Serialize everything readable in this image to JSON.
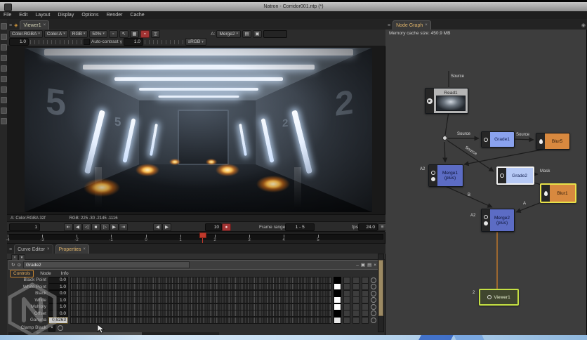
{
  "title_bar": {
    "title": "Natron - Corridor001.ntp (*)"
  },
  "menu_bar": {
    "items": [
      "File",
      "Edit",
      "Layout",
      "Display",
      "Options",
      "Render",
      "Cache"
    ]
  },
  "icons": {
    "close": "×",
    "caret": "▾",
    "menu": "≡",
    "focus": "◈",
    "prev_kf": "⇤",
    "prev_frame": "◀",
    "play_backward": "◁",
    "stop": "■",
    "play_forward": "▷",
    "next_frame": "▶",
    "next_kf": "⇥",
    "in_arrow": "◀",
    "out_arrow": "▶",
    "rec": "●",
    "snapshot": "◉",
    "gamma": "γ",
    "check": "✓",
    "refresh": "↻",
    "center": "⊙",
    "minimize": "–",
    "float": "▣",
    "grid": "▤",
    "pointer": "↖",
    "checker": "▦",
    "proxy": "▫",
    "wipe": "◫",
    "node_play": "▶",
    "pane_extra": "▪"
  },
  "viewer": {
    "tab": "Viewer1",
    "layer": "Color.RGBA",
    "alpha_channel": "Color.A",
    "display_channels": "RGB",
    "zoom": "50%",
    "gain": "1.0",
    "auto_contrast": "Auto-contrast",
    "gamma_value": "1.0",
    "colorspace": "sRGB",
    "ab_label": "A:",
    "ab_input": "Merge2",
    "info_format": "A: Color.RGBA 32f",
    "info_rgb": "RGB: 225 .30 .2145 .1116",
    "current_frame": "1",
    "playhead_frame": "10",
    "frame_range_label": "Frame range",
    "frame_range_value": "1 - 5",
    "fps_label": "fps",
    "fps_value": "24.0",
    "timeline_ticks": [
      "-4",
      "-3",
      "-2",
      "-1",
      "0",
      "1",
      "2",
      "3",
      "4",
      "5"
    ]
  },
  "image": {
    "left_wall_digit": "5",
    "right_wall_digit": "2",
    "left_wall_digit_small": "5",
    "right_wall_digit_small": "2"
  },
  "node_graph": {
    "tab": "Node Graph",
    "memory_status": "Memory cache size: 450.9 MB",
    "nodes": {
      "read1": "Read1",
      "grade1": "Grade1",
      "blur5": "Blur5",
      "merge1": "Merge1",
      "merge1_op": "(plus)",
      "grade2": "Grade2",
      "blur1": "Blur1",
      "merge2": "Merge2",
      "merge2_op": "(plus)",
      "viewer1": "Viewer1"
    },
    "edge_labels": {
      "read_source": "Source",
      "grade1_source": "Source",
      "blur5_source": "Source",
      "grade2_source": "Source",
      "merge1_a2": "A2",
      "merge2_a2": "A2",
      "merge2_b": "B",
      "merge2_a": "A",
      "grade2_mask": "Mask",
      "viewer_input": "2"
    }
  },
  "properties": {
    "tab_curve_editor": "Curve Editor",
    "tab_properties": "Properties",
    "node_name": "Grade2",
    "subtabs": [
      "Controls",
      "Node",
      "Info"
    ],
    "params": [
      {
        "label": "Black Point",
        "value": "0.0",
        "swatch": "#000000"
      },
      {
        "label": "White Point",
        "value": "1.0",
        "swatch": "#ffffff"
      },
      {
        "label": "Black",
        "value": "0.0",
        "swatch": "#000000"
      },
      {
        "label": "White",
        "value": "1.0",
        "swatch": "#ffffff"
      },
      {
        "label": "Multiply",
        "value": "1.0",
        "swatch": "#ffffff"
      },
      {
        "label": "Offset",
        "value": "0.0",
        "swatch": "#000000"
      },
      {
        "label": "Gamma",
        "value": "0.6263",
        "swatch": "#e6e6e6"
      }
    ],
    "clamp_black_label": "Clamp Black"
  },
  "colors": {
    "merge_node": "#5c6cc4",
    "grade_node": "#8aa2ee",
    "grade_selected_fill": "#b6c9f5",
    "blur_node": "#d8893f",
    "selection_yellow": "#e8e24a",
    "viewer_node_border": "#c5e043",
    "active_connection": "#b5722e",
    "playhead_red": "#c0392b",
    "focused_tab_text": "#ddb269"
  }
}
